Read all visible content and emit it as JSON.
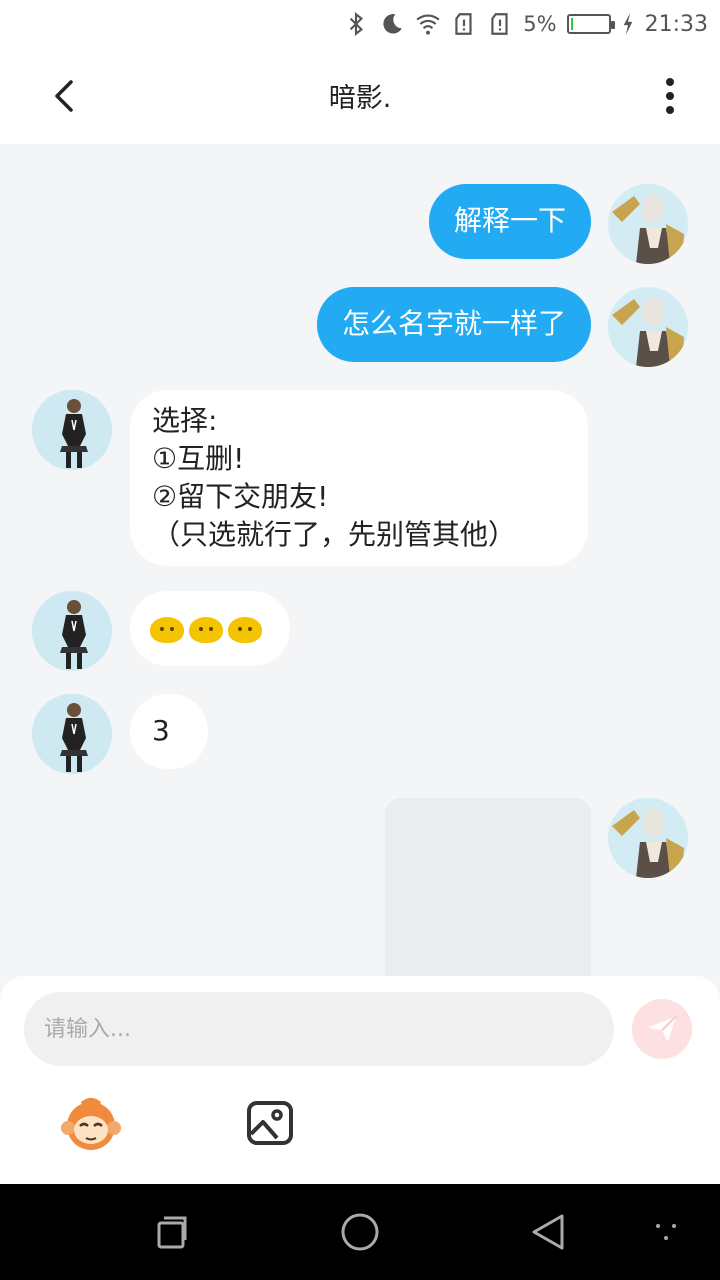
{
  "status_bar": {
    "battery_percent_text": "5%",
    "battery_level": 0.05,
    "time": "21:33",
    "icons": [
      "bluetooth-icon",
      "moon-icon",
      "wifi-icon",
      "sim1-icon",
      "sim2-icon",
      "charging-icon"
    ]
  },
  "header": {
    "title": "暗影.",
    "back_icon": "chevron-left-icon",
    "more_icon": "more-vertical-icon"
  },
  "messages": [
    {
      "direction": "out",
      "type": "text",
      "lines": [
        "解释一下"
      ]
    },
    {
      "direction": "out",
      "type": "text",
      "lines": [
        "怎么名字就一样了"
      ]
    },
    {
      "direction": "in",
      "type": "text",
      "lines": [
        "选择:",
        "①互删!",
        "②留下交朋友!",
        "（只选就行了，先别管其他）"
      ]
    },
    {
      "direction": "in",
      "type": "emoji",
      "emoji_icon": "silent-face-emoji",
      "count": 3
    },
    {
      "direction": "in",
      "type": "text",
      "lines": [
        "3"
      ]
    },
    {
      "direction": "out",
      "type": "image"
    }
  ],
  "composer": {
    "placeholder": "请输入...",
    "send_icon": "paper-plane-icon",
    "sticker_icon": "monkey-sticker-icon",
    "image_icon": "image-icon"
  },
  "nav_bar": {
    "icons": [
      "recent-apps-icon",
      "home-icon",
      "back-triangle-icon",
      "menu-dots-icon"
    ]
  },
  "colors": {
    "outgoing_bubble": "#22aaf3",
    "incoming_bubble": "#ffffff",
    "chat_background": "#f4f5f7",
    "send_button": "#fde0e0"
  }
}
